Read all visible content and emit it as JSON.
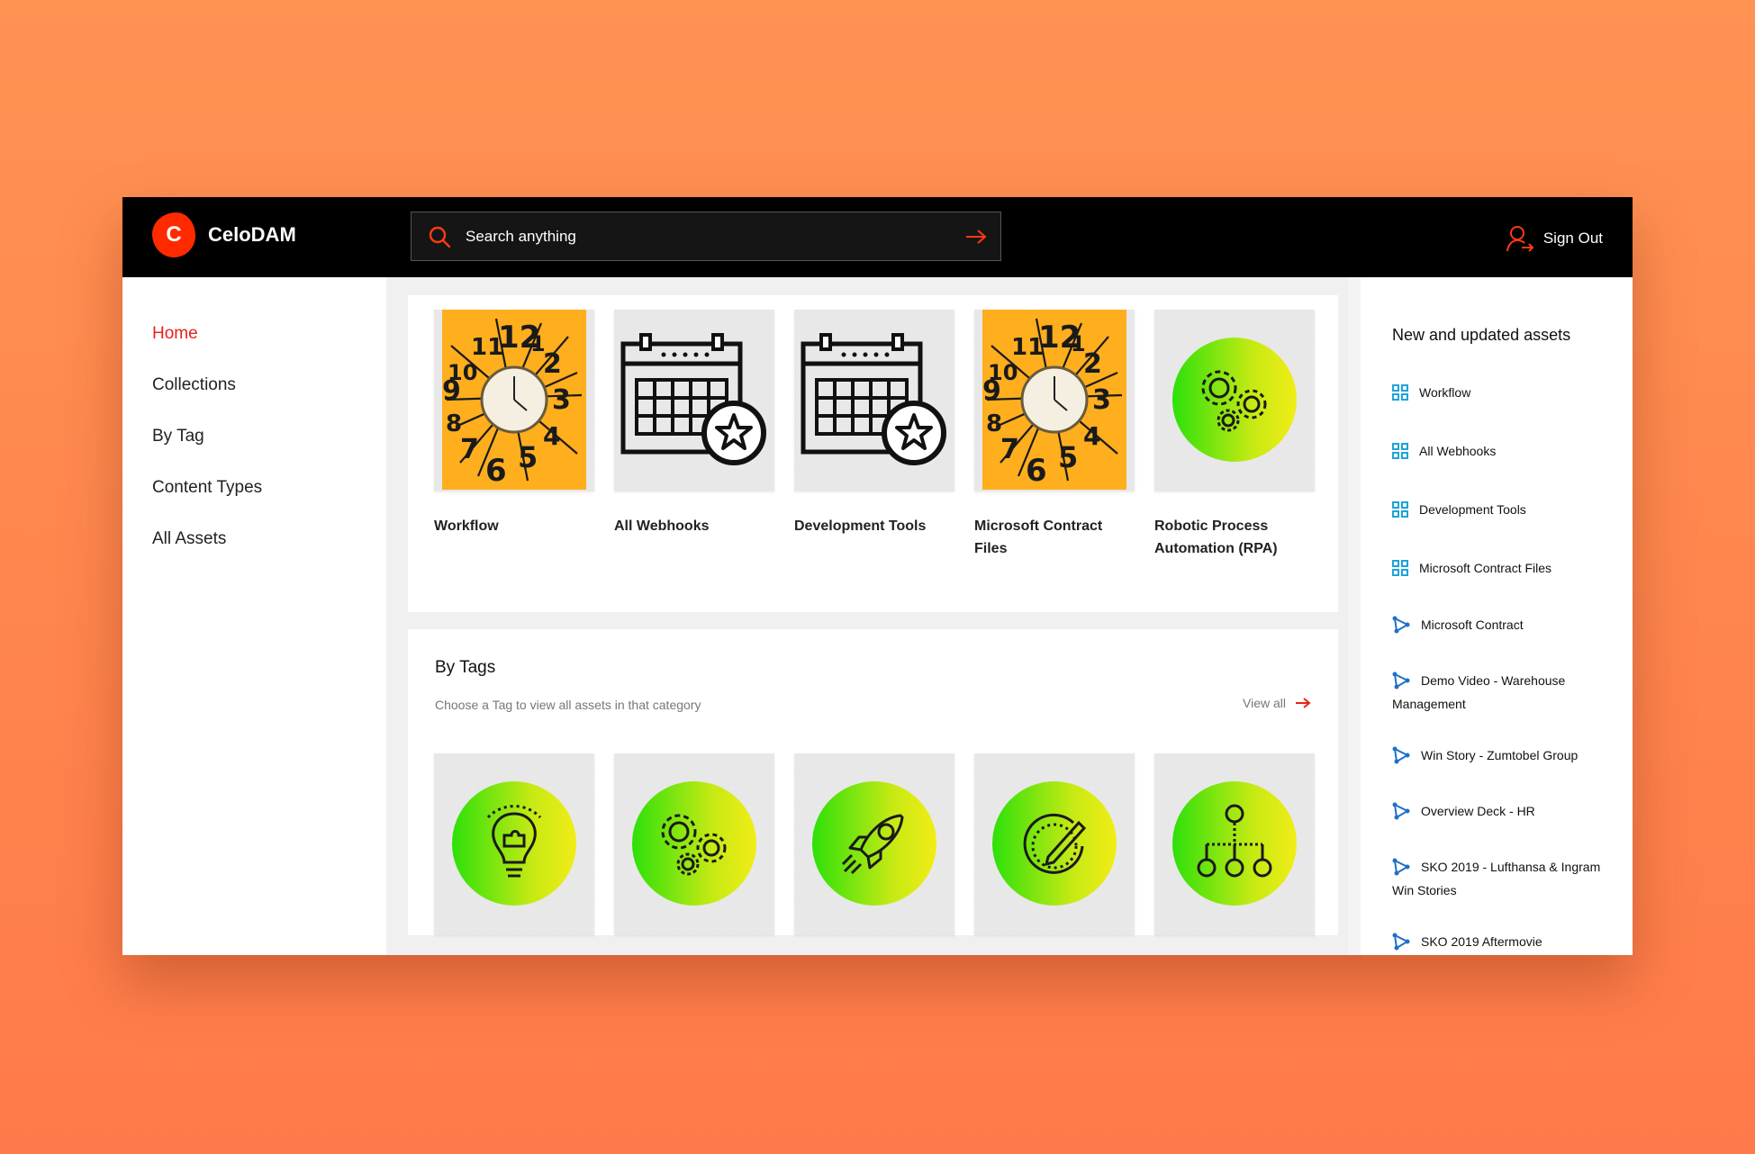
{
  "app": {
    "name": "CeloDAM",
    "logo_letter": "C"
  },
  "header": {
    "search_placeholder": "Search anything",
    "sign_out": "Sign Out"
  },
  "sidebar": {
    "items": [
      "Home",
      "Collections",
      "By Tag",
      "Content Types",
      "All Assets"
    ],
    "active": "Home"
  },
  "collections": [
    {
      "label": "Workflow",
      "art": "clock-art"
    },
    {
      "label": "All Webhooks",
      "art": "calendar-star-icon"
    },
    {
      "label": "Development Tools",
      "art": "calendar-star-icon"
    },
    {
      "label": "Microsoft Contract Files",
      "art": "clock-art"
    },
    {
      "label": "Robotic Process Automation (RPA)",
      "art": "gears-icon"
    }
  ],
  "by_tags": {
    "title": "By Tags",
    "subtitle": "Choose a Tag to view all assets in that category",
    "view_all": "View all",
    "tiles": [
      "lightbulb-puzzle-icon",
      "gears-icon",
      "rocket-icon",
      "pencil-circle-icon",
      "people-hierarchy-icon"
    ]
  },
  "right_panel": {
    "title": "New and updated assets",
    "items": [
      {
        "label": "Workflow",
        "icon": "grid-icon"
      },
      {
        "label": "All Webhooks",
        "icon": "grid-icon"
      },
      {
        "label": "Development Tools",
        "icon": "grid-icon"
      },
      {
        "label": "Microsoft Contract Files",
        "icon": "grid-icon"
      },
      {
        "label": "Microsoft Contract",
        "icon": "share-icon"
      },
      {
        "label": "Demo Video - Warehouse Management",
        "icon": "share-icon"
      },
      {
        "label": "Win Story - Zumtobel Group",
        "icon": "share-icon"
      },
      {
        "label": "Overview Deck - HR",
        "icon": "share-icon"
      },
      {
        "label": "SKO 2019 - Lufthansa & Ingram Win Stories",
        "icon": "share-icon"
      },
      {
        "label": "SKO 2019 Aftermovie",
        "icon": "share-icon"
      }
    ]
  },
  "colors": {
    "accent": "#e8221b",
    "topbar": "#000000",
    "icon_blue": "#1fa3d8",
    "clock_bg": "#ffae1e"
  }
}
